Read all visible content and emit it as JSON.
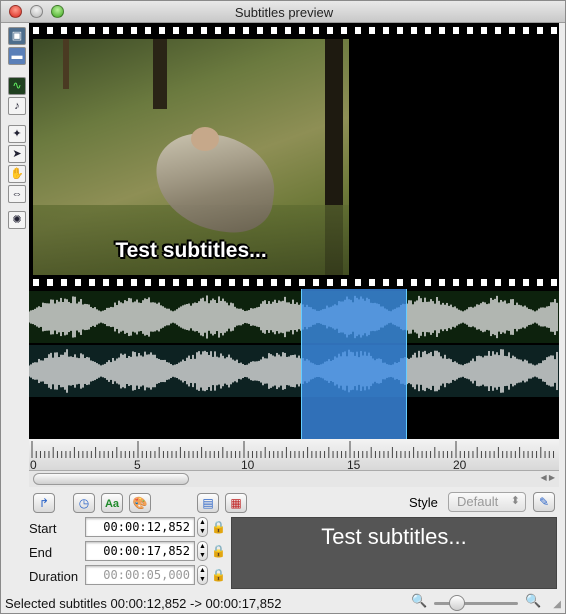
{
  "window": {
    "title": "Subtitles preview"
  },
  "colors": {
    "selection": "#3c8ce6",
    "waveform": "#e8e8e8",
    "preview_bg": "#555555"
  },
  "left_tools": [
    {
      "name": "video-view-icon"
    },
    {
      "name": "waveform-view-icon"
    },
    {
      "name": "waveform-toggle-icon"
    },
    {
      "name": "audio-speaker-icon"
    },
    {
      "name": "magic-wand-icon"
    },
    {
      "name": "pointer-icon"
    },
    {
      "name": "hand-icon"
    },
    {
      "name": "resize-arrows-icon"
    },
    {
      "name": "effects-icon"
    }
  ],
  "video": {
    "subtitle_overlay": "Test subtitles..."
  },
  "timeline": {
    "ruler_labels": [
      "0",
      "5",
      "10",
      "15",
      "20"
    ],
    "selection": {
      "start": "00:00:12,852",
      "end": "00:00:17,852"
    }
  },
  "toolbar": {
    "style_label": "Style",
    "style_value": "Default"
  },
  "fields": {
    "start_label": "Start",
    "start_value": "00:00:12,852",
    "end_label": "End",
    "end_value": "00:00:17,852",
    "duration_label": "Duration",
    "duration_value": "00:00:05,000"
  },
  "preview": {
    "text": "Test subtitles..."
  },
  "status": {
    "text": "Selected subtitles 00:00:12,852 -> 00:00:17,852"
  }
}
